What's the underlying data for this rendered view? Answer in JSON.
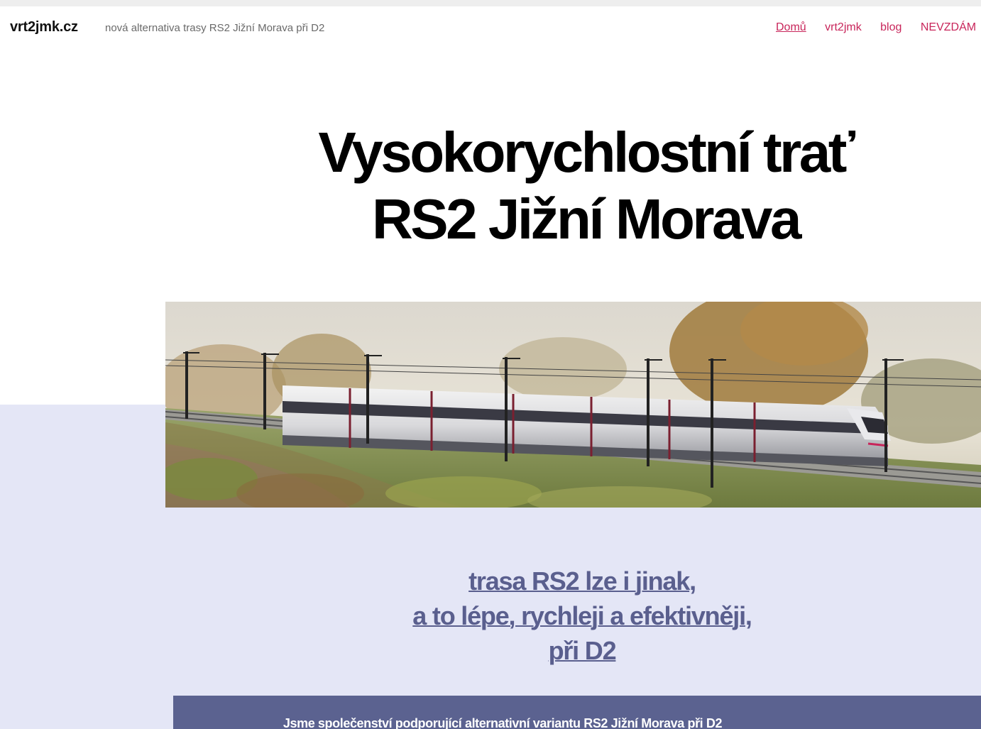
{
  "header": {
    "site_title": "vrt2jmk.cz",
    "site_description": "nová alternativa trasy RS2 Jižní Morava při D2",
    "nav": [
      {
        "label": "Domů"
      },
      {
        "label": "vrt2jmk"
      },
      {
        "label": "blog"
      },
      {
        "label": "NEVZDÁM"
      }
    ]
  },
  "hero": {
    "title_line1": "Vysokorychlostní trať",
    "title_line2": "RS2 Jižní Morava"
  },
  "tagline": {
    "line1_link": "trasa RS2 lze i jinak",
    "line1_suffix": ",",
    "line2_link": "a to lépe, rychleji a efektivněji",
    "line2_suffix": ",",
    "line3_link": "při D2"
  },
  "band": {
    "text": "Jsme společenství podporující alternativní variantu RS2 Jižní Morava při D2"
  },
  "colors": {
    "nav_link": "#c8255a",
    "tagline": "#5a5f8e",
    "band_bg": "#5b6290",
    "lower_bg": "#e4e6f6"
  }
}
